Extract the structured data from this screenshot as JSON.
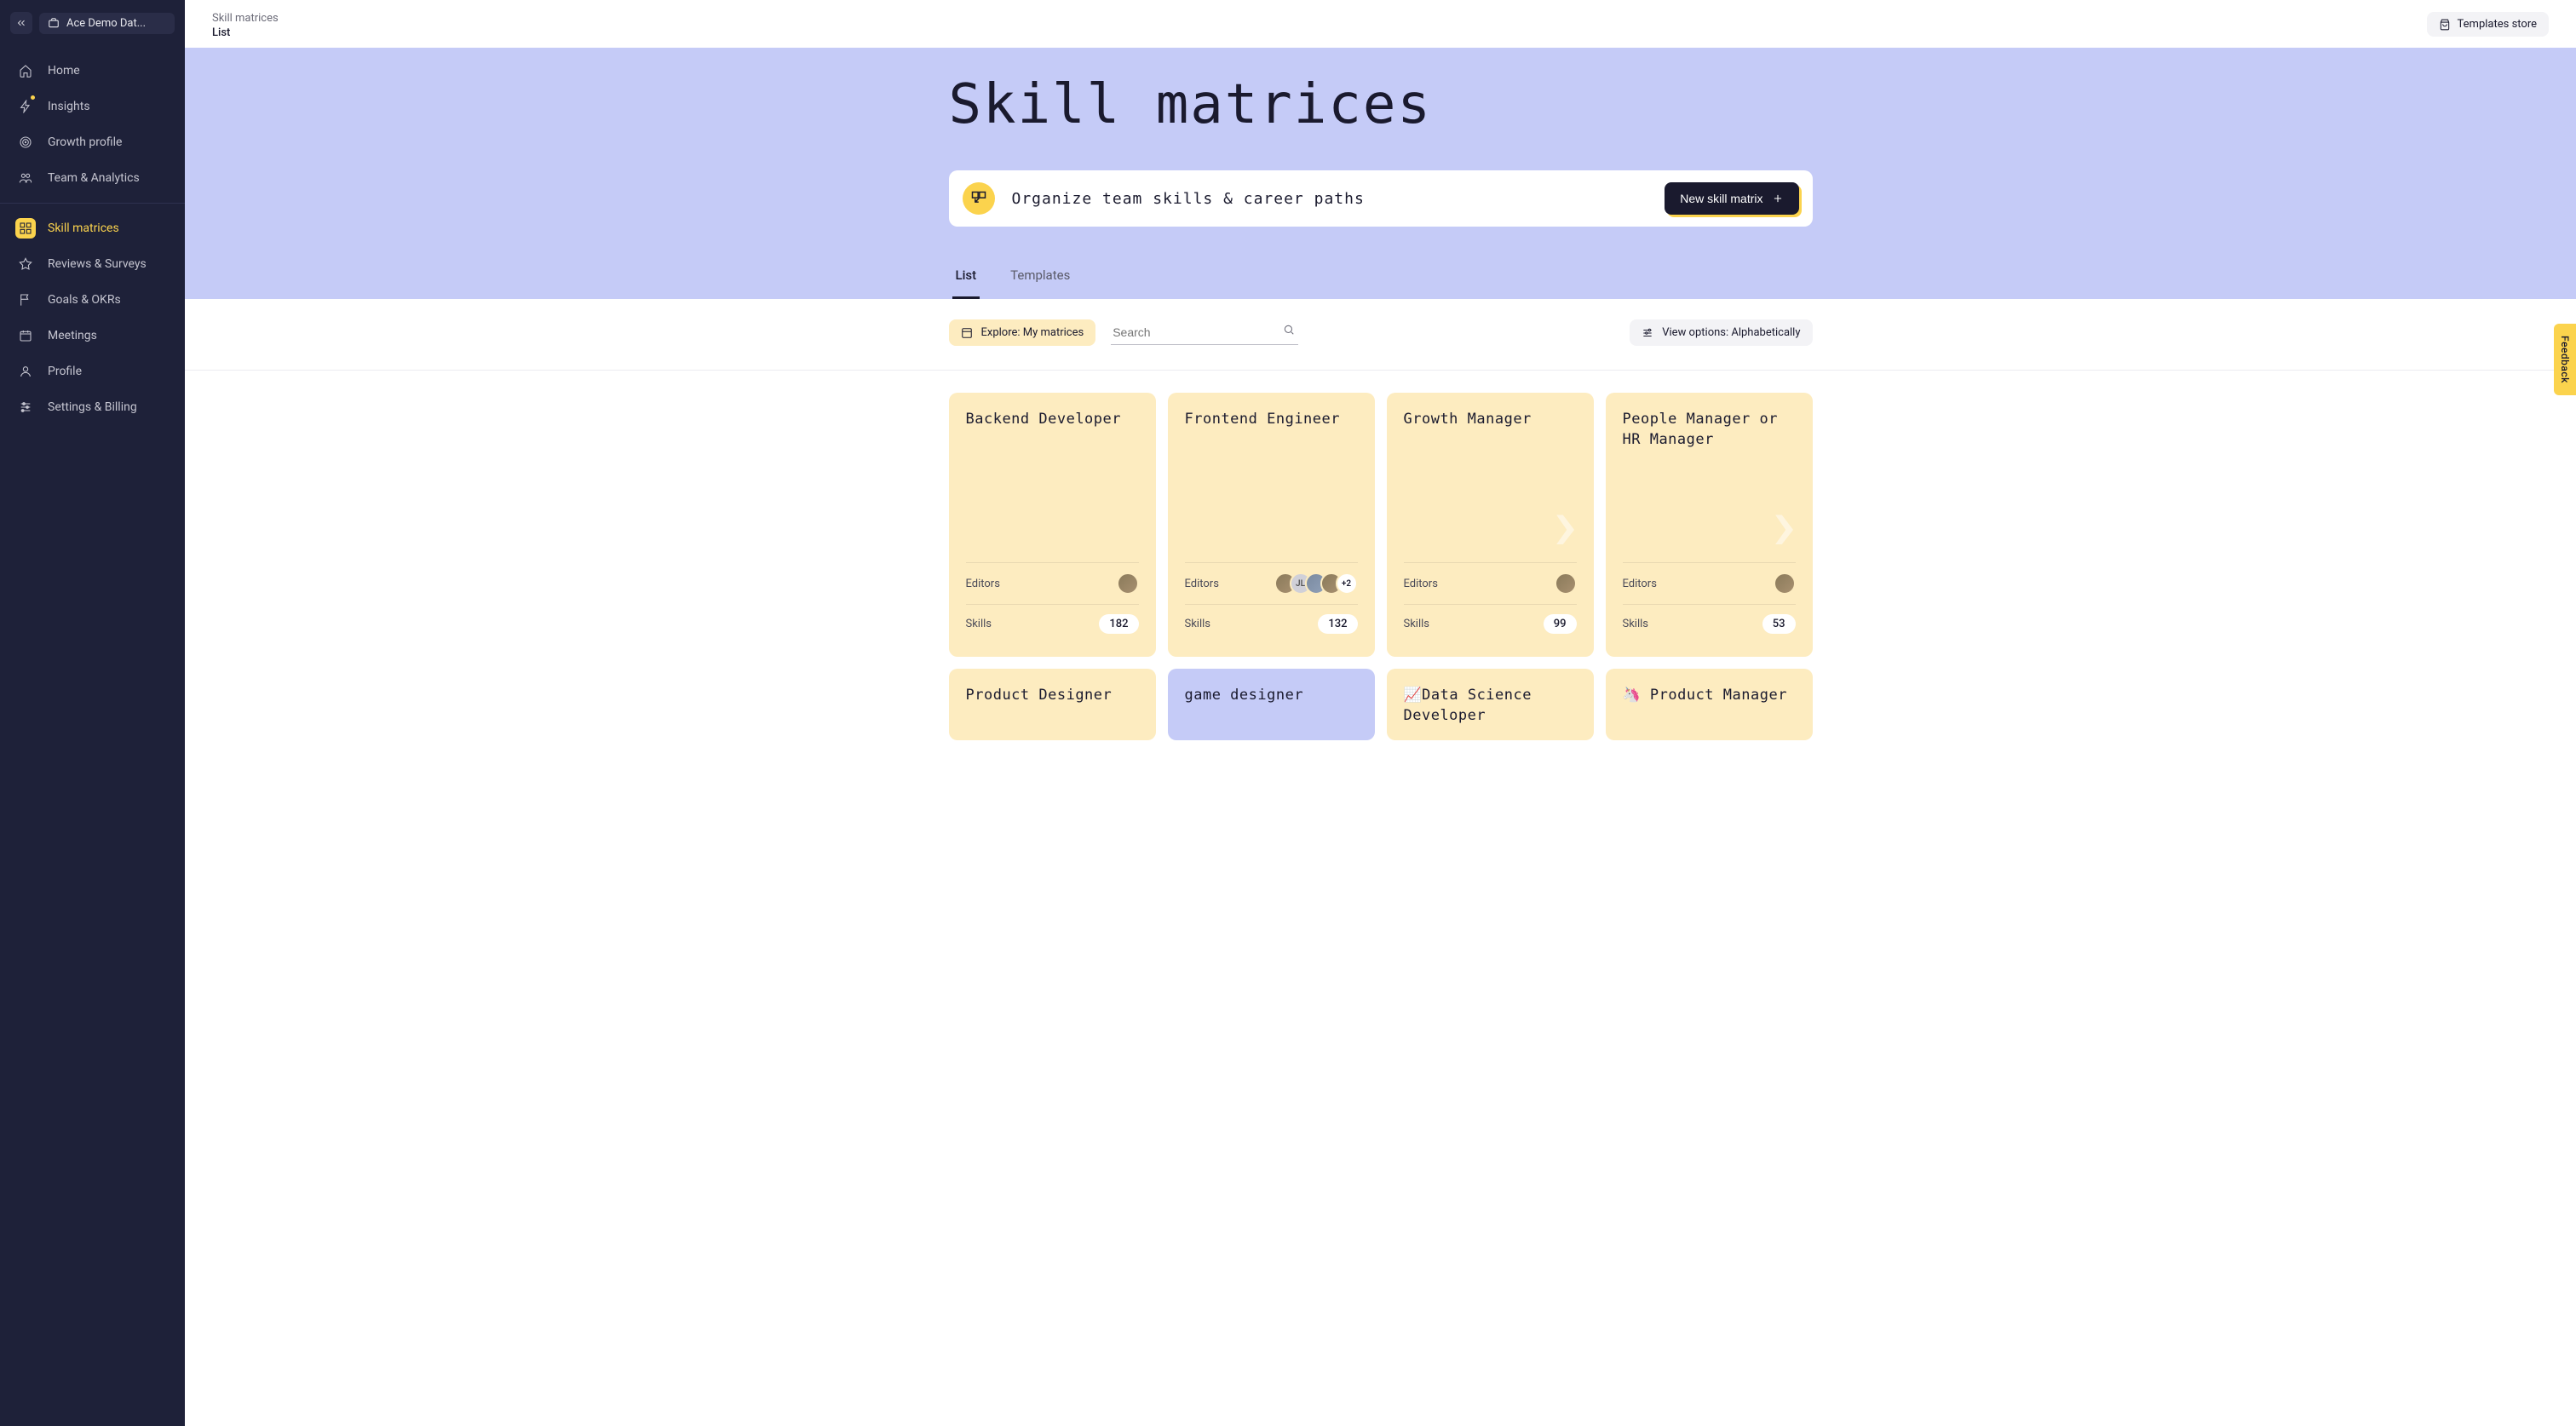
{
  "workspace": {
    "name": "Ace Demo Dat..."
  },
  "breadcrumb": {
    "main": "Skill matrices",
    "sub": "List"
  },
  "topbar": {
    "templates_store": "Templates store"
  },
  "nav": {
    "section1": [
      {
        "label": "Home",
        "icon": "home"
      },
      {
        "label": "Insights",
        "icon": "bolt",
        "dot": true
      },
      {
        "label": "Growth profile",
        "icon": "target"
      },
      {
        "label": "Team & Analytics",
        "icon": "users"
      }
    ],
    "section2": [
      {
        "label": "Skill matrices",
        "icon": "grid",
        "active": true
      },
      {
        "label": "Reviews & Surveys",
        "icon": "star"
      },
      {
        "label": "Goals & OKRs",
        "icon": "flag"
      },
      {
        "label": "Meetings",
        "icon": "calendar"
      },
      {
        "label": "Profile",
        "icon": "user"
      },
      {
        "label": "Settings & Billing",
        "icon": "sliders"
      }
    ]
  },
  "hero": {
    "title": "Skill matrices",
    "organize": "Organize team skills & career paths",
    "new_button": "New skill matrix"
  },
  "tabs": {
    "list": "List",
    "templates": "Templates"
  },
  "controls": {
    "explore_label": "Explore: My matrices",
    "search_placeholder": "Search",
    "view_options": "View options: Alphabetically"
  },
  "meta_labels": {
    "editors": "Editors",
    "skills": "Skills"
  },
  "cards": [
    {
      "title": "Backend Developer",
      "color": "yellow",
      "arrows": false,
      "editors": [
        {
          "t": "img"
        }
      ],
      "skills": "182"
    },
    {
      "title": "Frontend Engineer",
      "color": "yellow",
      "arrows": false,
      "editors": [
        {
          "t": "img"
        },
        {
          "t": "initials",
          "v": "JL"
        },
        {
          "t": "img2"
        },
        {
          "t": "img"
        },
        {
          "t": "more",
          "v": "+2"
        }
      ],
      "skills": "132"
    },
    {
      "title": "Growth Manager",
      "color": "yellow",
      "arrows": true,
      "editors": [
        {
          "t": "img"
        }
      ],
      "skills": "99"
    },
    {
      "title": "People Manager or HR Manager",
      "color": "yellow",
      "arrows": true,
      "editors": [
        {
          "t": "img"
        }
      ],
      "skills": "53"
    }
  ],
  "cards_row2": [
    {
      "title": "Product Designer",
      "color": "yellow"
    },
    {
      "title": "game designer",
      "color": "blue"
    },
    {
      "title": "📈Data Science Developer",
      "color": "yellow"
    },
    {
      "title": "🦄 Product Manager",
      "color": "yellow"
    }
  ],
  "feedback": {
    "label": "Feedback"
  }
}
